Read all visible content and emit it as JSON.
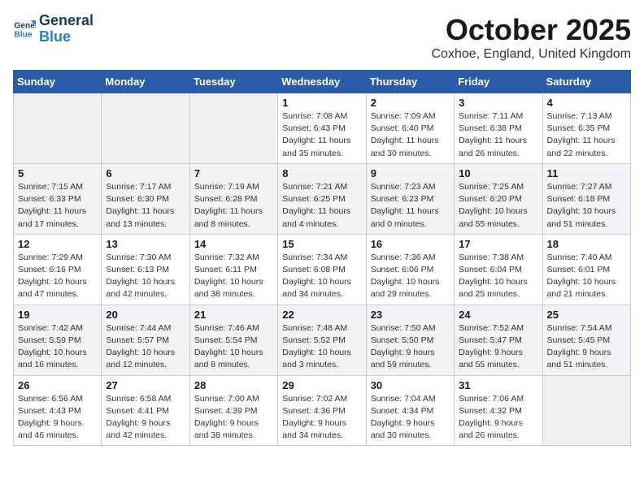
{
  "header": {
    "logo_line1": "General",
    "logo_line2": "Blue",
    "month": "October 2025",
    "location": "Coxhoe, England, United Kingdom"
  },
  "days_of_week": [
    "Sunday",
    "Monday",
    "Tuesday",
    "Wednesday",
    "Thursday",
    "Friday",
    "Saturday"
  ],
  "weeks": [
    [
      {
        "num": "",
        "info": ""
      },
      {
        "num": "",
        "info": ""
      },
      {
        "num": "",
        "info": ""
      },
      {
        "num": "1",
        "info": "Sunrise: 7:08 AM\nSunset: 6:43 PM\nDaylight: 11 hours\nand 35 minutes."
      },
      {
        "num": "2",
        "info": "Sunrise: 7:09 AM\nSunset: 6:40 PM\nDaylight: 11 hours\nand 30 minutes."
      },
      {
        "num": "3",
        "info": "Sunrise: 7:11 AM\nSunset: 6:38 PM\nDaylight: 11 hours\nand 26 minutes."
      },
      {
        "num": "4",
        "info": "Sunrise: 7:13 AM\nSunset: 6:35 PM\nDaylight: 11 hours\nand 22 minutes."
      }
    ],
    [
      {
        "num": "5",
        "info": "Sunrise: 7:15 AM\nSunset: 6:33 PM\nDaylight: 11 hours\nand 17 minutes."
      },
      {
        "num": "6",
        "info": "Sunrise: 7:17 AM\nSunset: 6:30 PM\nDaylight: 11 hours\nand 13 minutes."
      },
      {
        "num": "7",
        "info": "Sunrise: 7:19 AM\nSunset: 6:28 PM\nDaylight: 11 hours\nand 8 minutes."
      },
      {
        "num": "8",
        "info": "Sunrise: 7:21 AM\nSunset: 6:25 PM\nDaylight: 11 hours\nand 4 minutes."
      },
      {
        "num": "9",
        "info": "Sunrise: 7:23 AM\nSunset: 6:23 PM\nDaylight: 11 hours\nand 0 minutes."
      },
      {
        "num": "10",
        "info": "Sunrise: 7:25 AM\nSunset: 6:20 PM\nDaylight: 10 hours\nand 55 minutes."
      },
      {
        "num": "11",
        "info": "Sunrise: 7:27 AM\nSunset: 6:18 PM\nDaylight: 10 hours\nand 51 minutes."
      }
    ],
    [
      {
        "num": "12",
        "info": "Sunrise: 7:29 AM\nSunset: 6:16 PM\nDaylight: 10 hours\nand 47 minutes."
      },
      {
        "num": "13",
        "info": "Sunrise: 7:30 AM\nSunset: 6:13 PM\nDaylight: 10 hours\nand 42 minutes."
      },
      {
        "num": "14",
        "info": "Sunrise: 7:32 AM\nSunset: 6:11 PM\nDaylight: 10 hours\nand 38 minutes."
      },
      {
        "num": "15",
        "info": "Sunrise: 7:34 AM\nSunset: 6:08 PM\nDaylight: 10 hours\nand 34 minutes."
      },
      {
        "num": "16",
        "info": "Sunrise: 7:36 AM\nSunset: 6:06 PM\nDaylight: 10 hours\nand 29 minutes."
      },
      {
        "num": "17",
        "info": "Sunrise: 7:38 AM\nSunset: 6:04 PM\nDaylight: 10 hours\nand 25 minutes."
      },
      {
        "num": "18",
        "info": "Sunrise: 7:40 AM\nSunset: 6:01 PM\nDaylight: 10 hours\nand 21 minutes."
      }
    ],
    [
      {
        "num": "19",
        "info": "Sunrise: 7:42 AM\nSunset: 5:59 PM\nDaylight: 10 hours\nand 16 minutes."
      },
      {
        "num": "20",
        "info": "Sunrise: 7:44 AM\nSunset: 5:57 PM\nDaylight: 10 hours\nand 12 minutes."
      },
      {
        "num": "21",
        "info": "Sunrise: 7:46 AM\nSunset: 5:54 PM\nDaylight: 10 hours\nand 8 minutes."
      },
      {
        "num": "22",
        "info": "Sunrise: 7:48 AM\nSunset: 5:52 PM\nDaylight: 10 hours\nand 3 minutes."
      },
      {
        "num": "23",
        "info": "Sunrise: 7:50 AM\nSunset: 5:50 PM\nDaylight: 9 hours\nand 59 minutes."
      },
      {
        "num": "24",
        "info": "Sunrise: 7:52 AM\nSunset: 5:47 PM\nDaylight: 9 hours\nand 55 minutes."
      },
      {
        "num": "25",
        "info": "Sunrise: 7:54 AM\nSunset: 5:45 PM\nDaylight: 9 hours\nand 51 minutes."
      }
    ],
    [
      {
        "num": "26",
        "info": "Sunrise: 6:56 AM\nSunset: 4:43 PM\nDaylight: 9 hours\nand 46 minutes."
      },
      {
        "num": "27",
        "info": "Sunrise: 6:58 AM\nSunset: 4:41 PM\nDaylight: 9 hours\nand 42 minutes."
      },
      {
        "num": "28",
        "info": "Sunrise: 7:00 AM\nSunset: 4:39 PM\nDaylight: 9 hours\nand 38 minutes."
      },
      {
        "num": "29",
        "info": "Sunrise: 7:02 AM\nSunset: 4:36 PM\nDaylight: 9 hours\nand 34 minutes."
      },
      {
        "num": "30",
        "info": "Sunrise: 7:04 AM\nSunset: 4:34 PM\nDaylight: 9 hours\nand 30 minutes."
      },
      {
        "num": "31",
        "info": "Sunrise: 7:06 AM\nSunset: 4:32 PM\nDaylight: 9 hours\nand 26 minutes."
      },
      {
        "num": "",
        "info": ""
      }
    ]
  ]
}
